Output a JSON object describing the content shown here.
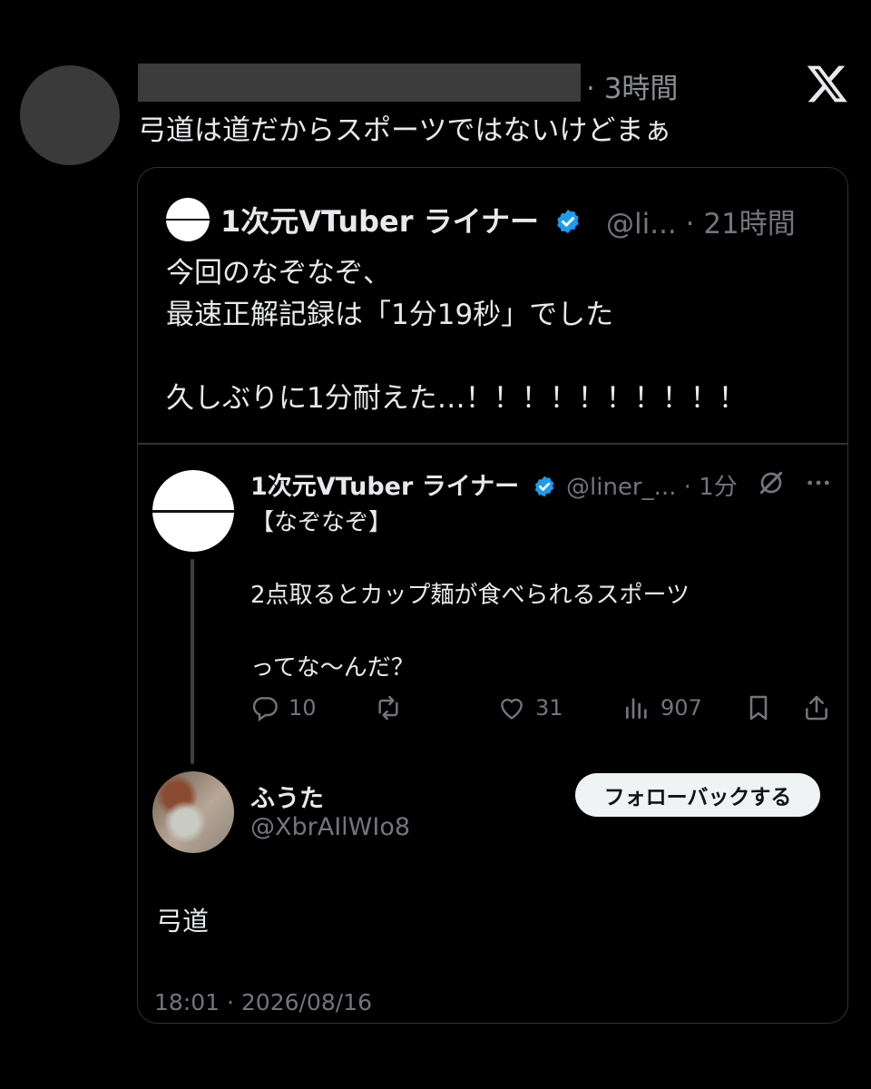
{
  "header": {
    "time": "· 3時間",
    "text": "弓道は道だからスポーツではないけどまぁ"
  },
  "quote": {
    "name": "1次元VTuber ライナー",
    "handle_time": "@li... · 21時間",
    "body": "今回のなぞなぞ、\n最速正解記録は「1分19秒」でした\n\n久しぶりに1分耐えた…！！！！！！！！！！"
  },
  "reply": {
    "name": "1次元VTuber ライナー",
    "handle_time": "@liner_... · 1分",
    "body": "【なぞなぞ】\n\n2点取るとカップ麺が食べられるスポーツ\n\nってな〜んだ？",
    "actions": {
      "replies": "10",
      "retweets": "",
      "likes": "31",
      "views": "907"
    }
  },
  "follower": {
    "name": "ふうた",
    "handle": "@XbrAIlWIo8",
    "button": "フォローバックする",
    "text": "弓道",
    "timestamp": "18:01 · 2026/08/16"
  },
  "colors": {
    "background": "#000000",
    "text": "#e7e9ea",
    "muted": "#71767b",
    "verified": "#1d9bf0",
    "border": "#2f3336"
  },
  "icons": [
    "x-logo-icon",
    "verified-badge-icon",
    "grok-icon",
    "more-icon",
    "reply-icon",
    "retweet-icon",
    "like-icon",
    "views-icon",
    "bookmark-icon",
    "share-icon"
  ]
}
